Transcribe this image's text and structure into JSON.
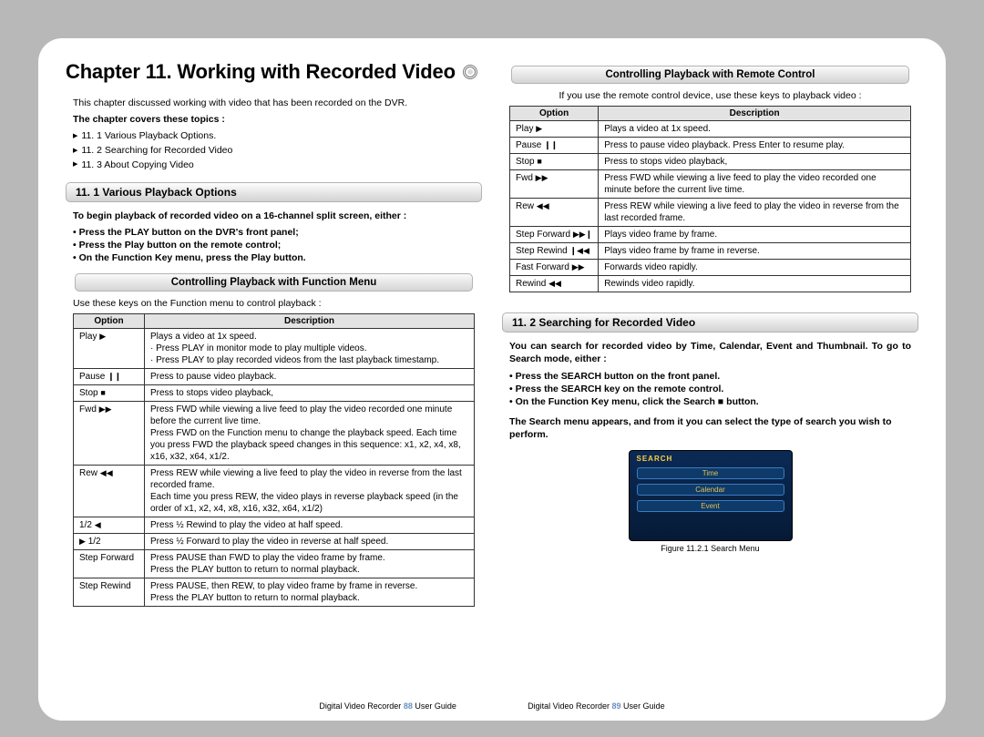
{
  "chapter": {
    "title": "Chapter 11. Working with Recorded Video"
  },
  "intro": "This chapter discussed working with video that has been recorded on the DVR.",
  "covers_label": "The chapter covers these topics :",
  "toc": [
    "11. 1 Various Playback Options.",
    "11. 2 Searching for Recorded Video",
    "11. 3 About Copying Video"
  ],
  "s11_1": {
    "title": "11. 1 Various Playback Options",
    "lead": "To begin playback of recorded video on a 16-channel split screen, either :",
    "bullets": [
      "Press the PLAY button on the DVR's front panel;",
      "Press the Play button on the remote control;",
      "On the Function Key menu, press the Play button."
    ],
    "sub1_title": "Controlling Playback with Function Menu",
    "sub1_lead": "Use these keys on the Function menu to control playback :",
    "table1_headers": {
      "opt": "Option",
      "desc": "Description"
    },
    "table1": [
      {
        "opt": "Play  ▶",
        "desc": "Plays a video at 1x speed.\n· Press PLAY in monitor mode to play multiple videos.\n· Press PLAY to play recorded videos from the last playback timestamp."
      },
      {
        "opt": "Pause  ❙❙",
        "desc": "Press to pause video playback."
      },
      {
        "opt": "Stop  ■",
        "desc": "Press to stops video playback,"
      },
      {
        "opt": "Fwd  ▶▶",
        "desc": "Press FWD while viewing a live feed to play the video recorded one minute before the current live time.\nPress FWD on the Function menu to change the playback speed. Each time you press FWD the playback speed changes in this sequence: x1, x2, x4, x8, x16, x32, x64, x1/2."
      },
      {
        "opt": "Rew  ◀◀",
        "desc": "Press REW while viewing a live feed to play the video in reverse from the last recorded frame.\nEach time you press REW, the video plays in reverse playback speed (in the order of x1, x2, x4, x8, x16, x32, x64, x1/2)"
      },
      {
        "opt": "1/2  ◀",
        "desc": "Press ½ Rewind to play the video at half speed."
      },
      {
        "opt": "▶  1/2",
        "desc": "Press ½ Forward to play the video in reverse at half speed."
      },
      {
        "opt": "Step Forward",
        "desc": "Press PAUSE than FWD to play the video frame by frame.\nPress the PLAY button to return to normal playback."
      },
      {
        "opt": "Step Rewind",
        "desc": "Press PAUSE, then REW, to play video frame by frame in reverse.\nPress the PLAY button to return to normal playback."
      }
    ]
  },
  "s_remote": {
    "title": "Controlling Playback with Remote Control",
    "lead": "If you use the remote control device, use these keys to playback video :",
    "table_headers": {
      "opt": "Option",
      "desc": "Description"
    },
    "table": [
      {
        "opt": "Play  ▶",
        "desc": "Plays a video at 1x speed."
      },
      {
        "opt": "Pause  ❙❙",
        "desc": "Press to pause video playback. Press Enter to resume play."
      },
      {
        "opt": "Stop  ■",
        "desc": "Press to stops video playback,"
      },
      {
        "opt": "Fwd  ▶▶",
        "desc": "Press FWD while viewing a live feed to play the video recorded one minute before the current live time."
      },
      {
        "opt": "Rew  ◀◀",
        "desc": "Press REW while viewing a live feed to play the video in reverse from the last recorded frame."
      },
      {
        "opt": "Step Forward ▶▶❙",
        "desc": "Plays video frame by frame."
      },
      {
        "opt": "Step Rewind ❙◀◀",
        "desc": "Plays video frame by frame in reverse."
      },
      {
        "opt": "Fast Forward ▶▶",
        "desc": "Forwards video rapidly."
      },
      {
        "opt": "Rewind  ◀◀",
        "desc": "Rewinds video rapidly."
      }
    ]
  },
  "s11_2": {
    "title": "11. 2 Searching for Recorded Video",
    "lead": "You can search for recorded video by Time, Calendar, Event and Thumbnail. To go to Search mode, either :",
    "bullets": [
      "Press the SEARCH button on the front panel.",
      "Press the SEARCH key on the remote control.",
      "On the Function Key menu, click the Search ■ button."
    ],
    "after": "The Search menu appears, and from it you can select the type of search you wish to perform.",
    "fig": {
      "title": "SEARCH",
      "items": [
        "Time",
        "Calendar",
        "Event"
      ],
      "caption": "Figure 11.2.1 Search Menu"
    }
  },
  "footer": {
    "prefix": "Digital Video Recorder",
    "suffix": "User Guide",
    "left_page": "88",
    "right_page": "89"
  }
}
